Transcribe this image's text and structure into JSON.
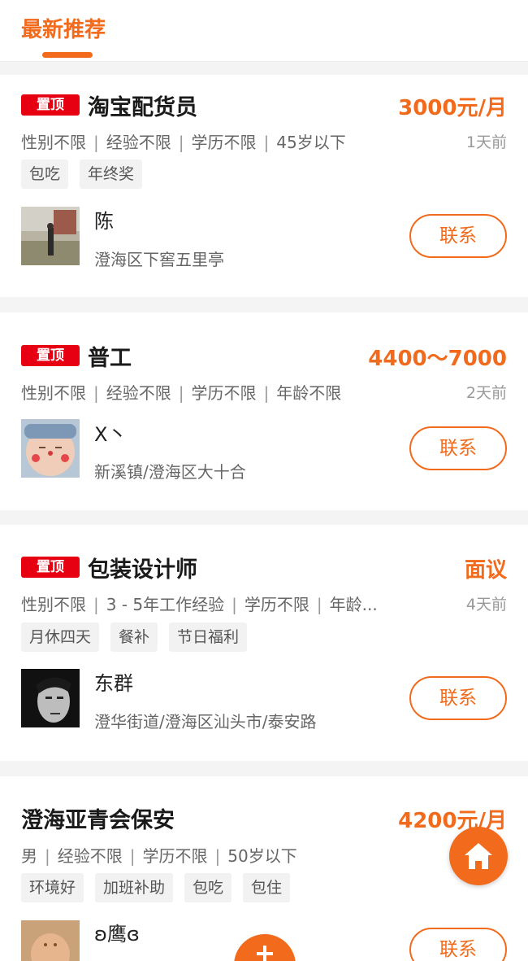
{
  "tabs": {
    "active_label": "最新推荐"
  },
  "colors": {
    "accent": "#f26a1b",
    "badge_red": "#e60012"
  },
  "jobs": [
    {
      "pinned_label": "置顶",
      "title": "淘宝配货员",
      "salary": "3000元/月",
      "requirements": [
        "性别不限",
        "经验不限",
        "学历不限",
        "45岁以下"
      ],
      "posted": "1天前",
      "tags": [
        "包吃",
        "年终奖"
      ],
      "poster": {
        "name": "陈",
        "location": "澄海区下窖五里亭"
      },
      "contact_label": "联系"
    },
    {
      "pinned_label": "置顶",
      "title": "普工",
      "salary": "4400～7000",
      "requirements": [
        "性别不限",
        "经验不限",
        "学历不限",
        "年龄不限"
      ],
      "posted": "2天前",
      "tags": [],
      "poster": {
        "name": "X丶",
        "location": "新溪镇/澄海区大十合"
      },
      "contact_label": "联系"
    },
    {
      "pinned_label": "置顶",
      "title": "包装设计师",
      "salary": "面议",
      "requirements": [
        "性别不限",
        "3 - 5年工作经验",
        "学历不限",
        "年龄..."
      ],
      "posted": "4天前",
      "tags": [
        "月休四天",
        "餐补",
        "节日福利"
      ],
      "poster": {
        "name": "东群",
        "location": "澄华街道/澄海区汕头市/泰安路"
      },
      "contact_label": "联系"
    },
    {
      "title": "澄海亚青会保安",
      "salary": "4200元/月",
      "requirements": [
        "男",
        "经验不限",
        "学历不限",
        "50岁以下"
      ],
      "tags": [
        "环境好",
        "加班补助",
        "包吃",
        "包住"
      ],
      "poster": {
        "name": "ʚ鹰ɞ"
      },
      "contact_label": "联系"
    }
  ]
}
